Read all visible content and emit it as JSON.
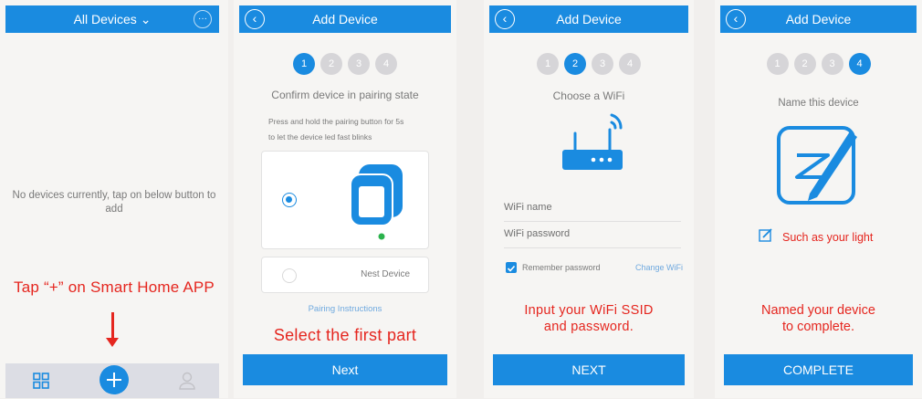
{
  "panel1": {
    "header_title": "All Devices",
    "more_glyph": "···",
    "empty_message": "No devices currently, tap on below button to add",
    "instruction": "Tap “+” on Smart Home APP",
    "tabs": [
      {
        "icon": "grid-icon"
      },
      {
        "icon": "plus-icon"
      },
      {
        "icon": "user-icon"
      }
    ]
  },
  "panel2": {
    "header_title": "Add Device",
    "steps": [
      "1",
      "2",
      "3",
      "4"
    ],
    "active_step": 1,
    "heading": "Confirm device in pairing state",
    "instructions_line1": "Press and hold the pairing button for 5s",
    "instructions_line2": "to let the device led fast blinks",
    "option2_label": "Nest Device",
    "pairing_link": "Pairing Instructions",
    "caption": "Select the first part",
    "next_label": "Next"
  },
  "panel3": {
    "header_title": "Add Device",
    "steps": [
      "1",
      "2",
      "3",
      "4"
    ],
    "active_step": 2,
    "heading": "Choose a WiFi",
    "wifi_name_label": "WiFi name",
    "wifi_password_label": "WiFi password",
    "remember_label": "Remember password",
    "remember_checked": true,
    "change_wifi": "Change WiFi",
    "caption_line1": "Input your WiFi SSID",
    "caption_line2": "and password.",
    "next_label": "NEXT"
  },
  "panel4": {
    "header_title": "Add Device",
    "steps": [
      "1",
      "2",
      "3",
      "4"
    ],
    "active_step": 4,
    "heading": "Name this device",
    "hint": "Such as your light",
    "caption_line1": "Named your device",
    "caption_line2": "to complete.",
    "complete_label": "COMPLETE"
  },
  "colors": {
    "accent": "#1a8be0",
    "caption_red": "#e5261f",
    "led_green": "#2bb24c"
  }
}
